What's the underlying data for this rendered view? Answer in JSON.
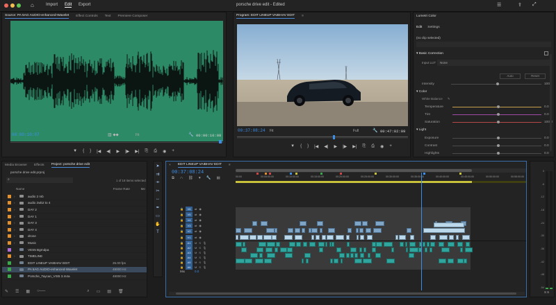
{
  "app": {
    "title": "porsche drive edit - Edited",
    "menu": [
      "Import",
      "Edit",
      "Export"
    ],
    "active_menu": "Edit"
  },
  "source_panel": {
    "tabs": [
      "Source: PA 5AG AUDIO-enhanced-Wavelet",
      "Effect Controls",
      "Text",
      "Premiere Composer"
    ],
    "timecode_in": "00:00:10:07",
    "timecode_out": "00:00:10:08",
    "fit": "Fit",
    "controls": [
      "▼",
      "{",
      "}",
      "|◀",
      "◀|",
      "▶",
      "|▶",
      "▶|",
      "⎘",
      "⎙",
      "◉",
      "+"
    ]
  },
  "program_panel": {
    "title": "Program: EDIT LINEUP VAIBHAV EDIT",
    "timecode_in": "00:37:08:24",
    "zoom": "Fit",
    "quality": "Full",
    "timecode_out": "00:47:02:09",
    "controls": [
      "▼",
      "{",
      "}",
      "|◀",
      "◀|",
      "▶",
      "|▶",
      "▶|",
      "⎘",
      "⎙",
      "◉",
      "+"
    ]
  },
  "lumetri": {
    "preset": "Lumetri Color",
    "tabs": [
      "Edit",
      "Settings"
    ],
    "no_clip": "(no clip selected)",
    "basic_correction": "Basic Correction",
    "input_lut_label": "Input LUT",
    "input_lut_value": "None",
    "buttons": [
      "Auto",
      "Reset"
    ],
    "intensity_label": "Intensity",
    "intensity_value": "100",
    "color_section": "Color",
    "white_balance": "White Balance",
    "color_rows": [
      {
        "label": "Temperature",
        "value": "0.0",
        "color": "#c9a24b"
      },
      {
        "label": "Tint",
        "value": "0.0",
        "color": "#a34ba8"
      },
      {
        "label": "Saturation",
        "value": "100.0",
        "color": "#b84848"
      }
    ],
    "light_section": "Light",
    "light_rows": [
      {
        "label": "Exposure",
        "value": "0.0"
      },
      {
        "label": "Contrast",
        "value": "0.0"
      },
      {
        "label": "Highlights",
        "value": "0.0"
      }
    ]
  },
  "project_panel": {
    "tabs": [
      "Media Browser",
      "Effects",
      "Project: porsche drive edit"
    ],
    "project_file": "porsche drive edit.prproj",
    "item_count": "1 of 18 items selected",
    "columns": [
      "Name",
      "Frame Rate",
      "Me"
    ],
    "items": [
      {
        "name": "audio 2 mb",
        "fps": "",
        "color": "#e0902c",
        "type": "folder"
      },
      {
        "name": "audio 2wb2 to 4",
        "fps": "",
        "color": "#e0902c",
        "type": "folder"
      },
      {
        "name": "DAY 2",
        "fps": "",
        "color": "#e0902c",
        "type": "folder"
      },
      {
        "name": "DAY 1",
        "fps": "",
        "color": "#e0902c",
        "type": "folder"
      },
      {
        "name": "DAY 3",
        "fps": "",
        "color": "#e0902c",
        "type": "folder"
      },
      {
        "name": "DAY 4",
        "fps": "",
        "color": "#e0902c",
        "type": "folder"
      },
      {
        "name": "drone",
        "fps": "",
        "color": "#e0902c",
        "type": "folder"
      },
      {
        "name": "Music",
        "fps": "",
        "color": "#e0902c",
        "type": "folder"
      },
      {
        "name": "VES5 Bgrndpa",
        "fps": "",
        "color": "#b06cd6",
        "type": "file"
      },
      {
        "name": "TIMELINE",
        "fps": "",
        "color": "#e0902c",
        "type": "folder"
      },
      {
        "name": "EDIT LINEUP VAIBHAV EDIT",
        "fps": "25.00 fps",
        "color": "#3ba84b",
        "type": "sequence"
      },
      {
        "name": "PA 5AG AUDIO-enhanced-Wavelet",
        "fps": "48000 Hz",
        "color": "#3ba84b",
        "type": "audio"
      },
      {
        "name": "Porsche_Taycan_VIS5 3.m4a",
        "fps": "48000 Hz",
        "color": "#3ba84b",
        "type": "audio"
      }
    ]
  },
  "timeline": {
    "title": "EDIT LINEUP VAIBHAV EDIT",
    "timecode": "00:37:08:24",
    "ruler": [
      "00:00",
      "00:05:00:00",
      "00:10:00:00",
      "00:15:00:00",
      "00:20:00:00",
      "00:25:00:00",
      "00:30:00:00",
      "00:35:00:00",
      "00:40:00:00",
      "00:45:00:00",
      "00:50:00:00",
      "00:55:00:00"
    ],
    "video_tracks": [
      "V6",
      "V5",
      "V4",
      "V3",
      "V2",
      "V1"
    ],
    "audio_tracks": [
      "A1",
      "A2",
      "A3",
      "A4",
      "A5",
      "A6"
    ],
    "mix_label": "Mix",
    "mix_value": "0.0"
  },
  "meter": {
    "labels": [
      "0",
      "-6",
      "-12",
      "-18",
      "-24",
      "-30",
      "-36",
      "-42",
      "-48",
      "-54"
    ],
    "footer": "S S"
  },
  "colors": {
    "accent": "#3d8ee6",
    "waveform_bg": "#2c8a67",
    "video_clip": "#7fa6c7",
    "audio_clip": "#2fa59e"
  }
}
